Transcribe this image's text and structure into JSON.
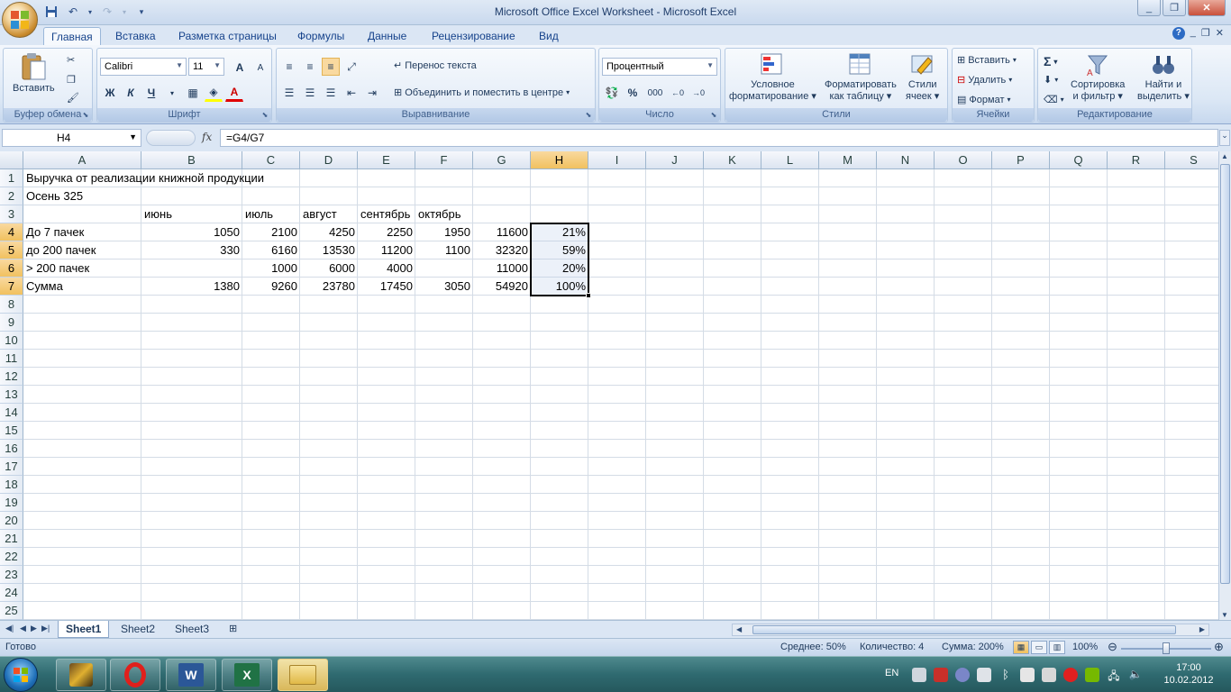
{
  "window": {
    "title": "Microsoft Office Excel Worksheet - Microsoft Excel"
  },
  "ribbon_tabs": [
    "Главная",
    "Вставка",
    "Разметка страницы",
    "Формулы",
    "Данные",
    "Рецензирование",
    "Вид"
  ],
  "ribbon": {
    "clipboard": {
      "label": "Буфер обмена",
      "paste": "Вставить"
    },
    "font": {
      "label": "Шрифт",
      "name": "Calibri",
      "size": "11",
      "bold": "Ж",
      "italic": "К",
      "underline": "Ч",
      "grow": "A",
      "shrink": "A"
    },
    "alignment": {
      "label": "Выравнивание",
      "wrap": "Перенос текста",
      "merge": "Объединить и поместить в центре"
    },
    "number": {
      "label": "Число",
      "format": "Процентный",
      "percent": "%",
      "thousands": "000"
    },
    "styles": {
      "label": "Стили",
      "conditional_1": "Условное",
      "conditional_2": "форматирование",
      "table_1": "Форматировать",
      "table_2": "как таблицу",
      "cell_1": "Стили",
      "cell_2": "ячеек"
    },
    "cells": {
      "label": "Ячейки",
      "insert": "Вставить",
      "delete": "Удалить",
      "format": "Формат"
    },
    "editing": {
      "label": "Редактирование",
      "sort_1": "Сортировка",
      "sort_2": "и фильтр",
      "find_1": "Найти и",
      "find_2": "выделить"
    }
  },
  "formula_bar": {
    "name_box": "H4",
    "fx": "fx",
    "formula": "=G4/G7"
  },
  "columns": [
    "A",
    "B",
    "C",
    "D",
    "E",
    "F",
    "G",
    "H",
    "I",
    "J",
    "K",
    "L",
    "M",
    "N",
    "O",
    "P",
    "Q",
    "R",
    "S"
  ],
  "rows": [
    "1",
    "2",
    "3",
    "4",
    "5",
    "6",
    "7",
    "8",
    "9",
    "10",
    "11",
    "12",
    "13",
    "14",
    "15",
    "16",
    "17",
    "18",
    "19",
    "20",
    "21",
    "22",
    "23",
    "24",
    "25"
  ],
  "cells": {
    "A1": "Выручка от реализации книжной продукции",
    "A2": "Осень 325",
    "B3": "июнь",
    "C3": "июль",
    "D3": "август",
    "E3": "сентябрь",
    "F3": "октябрь",
    "A4": "До 7 пачек",
    "B4": "1050",
    "C4": "2100",
    "D4": "4250",
    "E4": "2250",
    "F4": "1950",
    "G4": "11600",
    "H4": "21%",
    "A5": "до 200 пачек",
    "B5": "330",
    "C5": "6160",
    "D5": "13530",
    "E5": "11200",
    "F5": "1100",
    "G5": "32320",
    "H5": "59%",
    "A6": "> 200 пачек",
    "C6": "1000",
    "D6": "6000",
    "E6": "4000",
    "G6": "11000",
    "H6": "20%",
    "A7": "Сумма",
    "B7": "1380",
    "C7": "9260",
    "D7": "23780",
    "E7": "17450",
    "F7": "3050",
    "G7": "54920",
    "H7": "100%"
  },
  "selection": {
    "active_cell": "H4",
    "range": "H4:H7"
  },
  "sheet_tabs": [
    "Sheet1",
    "Sheet2",
    "Sheet3"
  ],
  "active_sheet": "Sheet1",
  "status_bar": {
    "ready": "Готово",
    "average": "Среднее: 50%",
    "count": "Количество: 4",
    "sum": "Сумма: 200%",
    "zoom": "100%"
  },
  "taskbar": {
    "language": "EN",
    "time": "17:00",
    "date": "10.02.2012"
  }
}
